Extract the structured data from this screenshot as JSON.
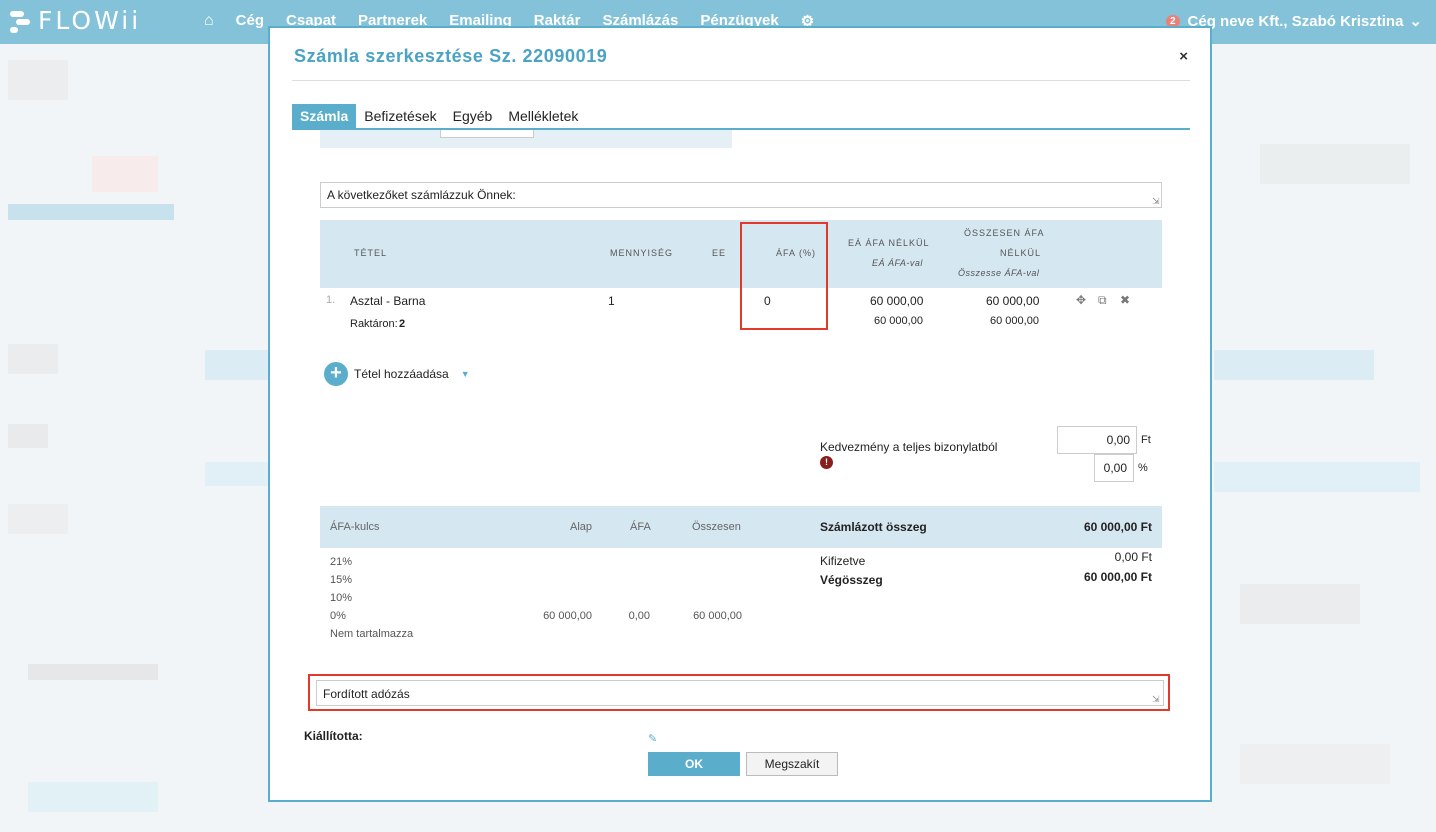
{
  "app": {
    "logo": "FLOWii"
  },
  "nav": {
    "items": [
      "Cég",
      "Csapat",
      "Partnerek",
      "Emailing",
      "Raktár",
      "Számlázás",
      "Pénzügyek"
    ],
    "user": "Cég neve Kft., Szabó Krisztina",
    "notification_count": "2"
  },
  "modal": {
    "title": "Számla szerkesztése Sz. 22090019",
    "close": "×",
    "tabs": [
      "Számla",
      "Befizetések",
      "Egyéb",
      "Mellékletek"
    ],
    "active_tab": "Számla",
    "intro_text": "A következőket számlázzuk Önnek:",
    "items_table": {
      "headers": {
        "item": "TÉTEL",
        "quantity": "MENNYISÉG",
        "unit": "EE",
        "vat": "ÁFA (%)",
        "unit_net": "EÁ ÁFA NÉLKÜL",
        "unit_gross": "EÁ ÁFA-val",
        "total_net_1": "ÖSSZESEN ÁFA",
        "total_net_2": "NÉLKÜL",
        "total_gross": "Összesse ÁFA-val"
      },
      "rows": [
        {
          "num": "1.",
          "name": "Asztal - Barna",
          "stock_label": "Raktáron:",
          "stock_value": "2",
          "quantity": "1",
          "vat": "0",
          "unit_net": "60 000,00",
          "unit_gross": "60 000,00",
          "total_net": "60 000,00",
          "total_gross": "60 000,00"
        }
      ]
    },
    "add_item_label": "Tétel hozzáadása",
    "discount": {
      "label": "Kedvezmény a teljes bizonylatból",
      "amount": "0,00",
      "amount_unit": "Ft",
      "percent": "0,00",
      "percent_unit": "%"
    },
    "vat_summary": {
      "headers": {
        "rate": "ÁFA-kulcs",
        "base": "Alap",
        "vat": "ÁFA",
        "total": "Összesen"
      },
      "rows": [
        {
          "rate": "21%",
          "base": "",
          "vat": "",
          "total": ""
        },
        {
          "rate": "15%",
          "base": "",
          "vat": "",
          "total": ""
        },
        {
          "rate": "10%",
          "base": "",
          "vat": "",
          "total": ""
        },
        {
          "rate": "0%",
          "base": "60 000,00",
          "vat": "0,00",
          "total": "60 000,00"
        },
        {
          "rate": "Nem tartalmazza",
          "base": "",
          "vat": "",
          "total": ""
        }
      ]
    },
    "totals": {
      "invoiced_label": "Számlázott összeg",
      "invoiced_value": "60 000,00 Ft",
      "paid_label": "Kifizetve",
      "paid_value": "0,00 Ft",
      "final_label": "Végösszeg",
      "final_value": "60 000,00 Ft"
    },
    "footer_text": "Fordított adózás",
    "issuer_label": "Kiállította:",
    "ok_label": "OK",
    "cancel_label": "Megszakít"
  },
  "colors": {
    "accent": "#5aaecb",
    "highlight": "#e23a2a",
    "table_header": "#d5e7f1"
  }
}
